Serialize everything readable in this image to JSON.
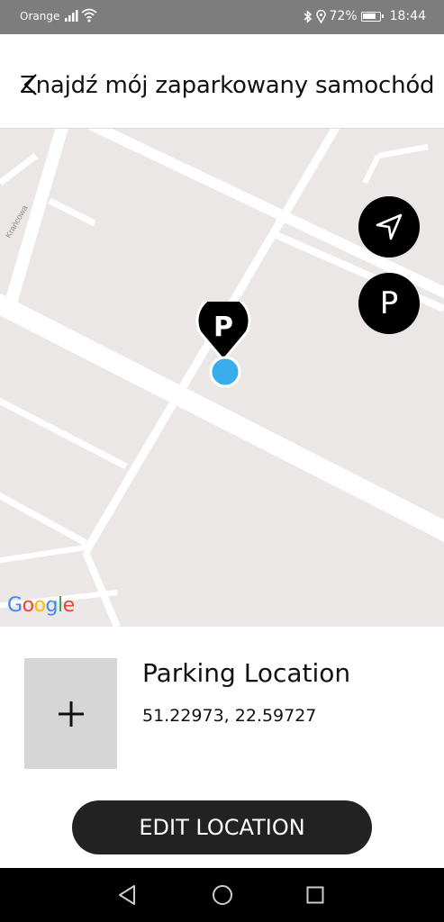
{
  "status_bar": {
    "carrier": "Orange",
    "battery": "72%",
    "time": "18:44"
  },
  "header": {
    "title": "Znajdź mój zaparkowany samochód"
  },
  "map": {
    "street_label": "Krańcowa",
    "park_fab_label": "P",
    "pin_label": "P",
    "google_logo": [
      "G",
      "o",
      "o",
      "g",
      "l",
      "e"
    ]
  },
  "location": {
    "title": "Parking Location",
    "coordinates": "51.22973, 22.59727"
  },
  "actions": {
    "edit_label": "EDIT LOCATION"
  },
  "colors": {
    "user_dot": "#3aaeec",
    "button": "#222222",
    "map_bg": "#ebe7e7"
  }
}
